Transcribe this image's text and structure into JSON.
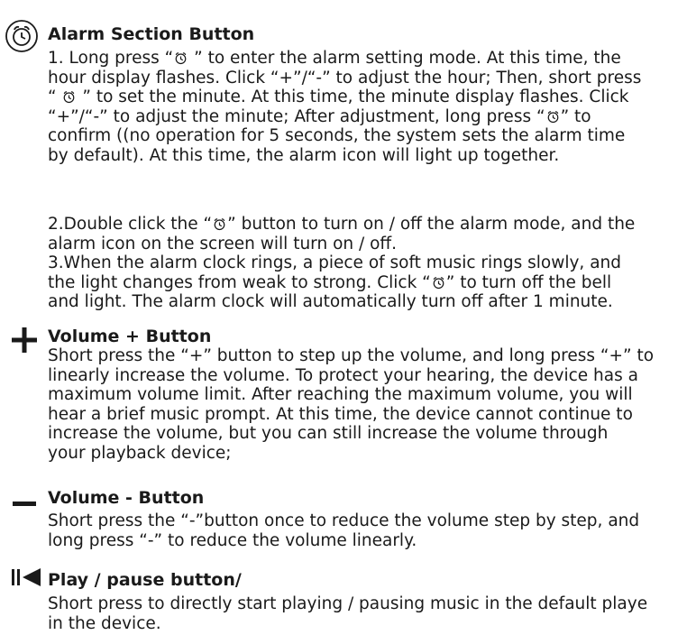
{
  "alarm": {
    "title": "Alarm Section Button",
    "para1_lines": [
      [
        "1. Long press “",
        "CLOCK",
        " ” to enter the alarm setting mode. At this time, the"
      ],
      [
        "hour display flashes. Click “+”/“-” to adjust the hour; Then, short press"
      ],
      [
        "“ ",
        "CLOCK",
        " ” to set the minute. At this time, the minute display flashes. Click"
      ],
      [
        "“+”/“-” to adjust the minute; After adjustment, long press “",
        "CLOCK",
        "” to"
      ],
      [
        "confirm ((no operation for 5 seconds, the system sets the alarm time"
      ],
      [
        "by default). At this time, the alarm icon will light up together."
      ]
    ],
    "para2_lines": [
      [
        "2.Double click the “",
        "CLOCK",
        "” button to turn on / off the alarm mode, and the"
      ],
      [
        "alarm icon on the screen will turn on / off."
      ]
    ],
    "para3_lines": [
      [
        "3.When the alarm clock rings, a piece of soft music rings slowly, and"
      ],
      [
        "the light changes from weak to strong. Click “",
        "CLOCK",
        "” to turn off the bell"
      ],
      [
        "and light. The alarm clock will automatically turn off after 1 minute."
      ]
    ]
  },
  "volume_up": {
    "title": "Volume + Button",
    "lines": [
      "Short press the “+” button to step up the volume, and long press “+” to",
      "linearly increase the volume. To protect your hearing, the device has a",
      "maximum volume limit. After reaching the maximum volume, you will",
      "hear a brief music prompt. At this time, the device cannot continue to",
      "increase the volume, but you can still increase the volume through",
      "your playback device;"
    ]
  },
  "volume_down": {
    "title": "Volume - Button",
    "lines": [
      "Short press the “-”button once to reduce the volume step by step, and",
      "long press “-” to reduce the volume linearly."
    ]
  },
  "play_pause": {
    "title": "Play / pause button/",
    "lines": [
      "Short press to directly start playing / pausing music in the default playe",
      "in the device."
    ]
  },
  "icons": {
    "alarm": "alarm-clock-icon",
    "plus": "plus-icon",
    "minus": "minus-icon",
    "play_pause": "play-pause-icon"
  },
  "colors": {
    "text": "#1a1a1a",
    "background": "#ffffff"
  }
}
